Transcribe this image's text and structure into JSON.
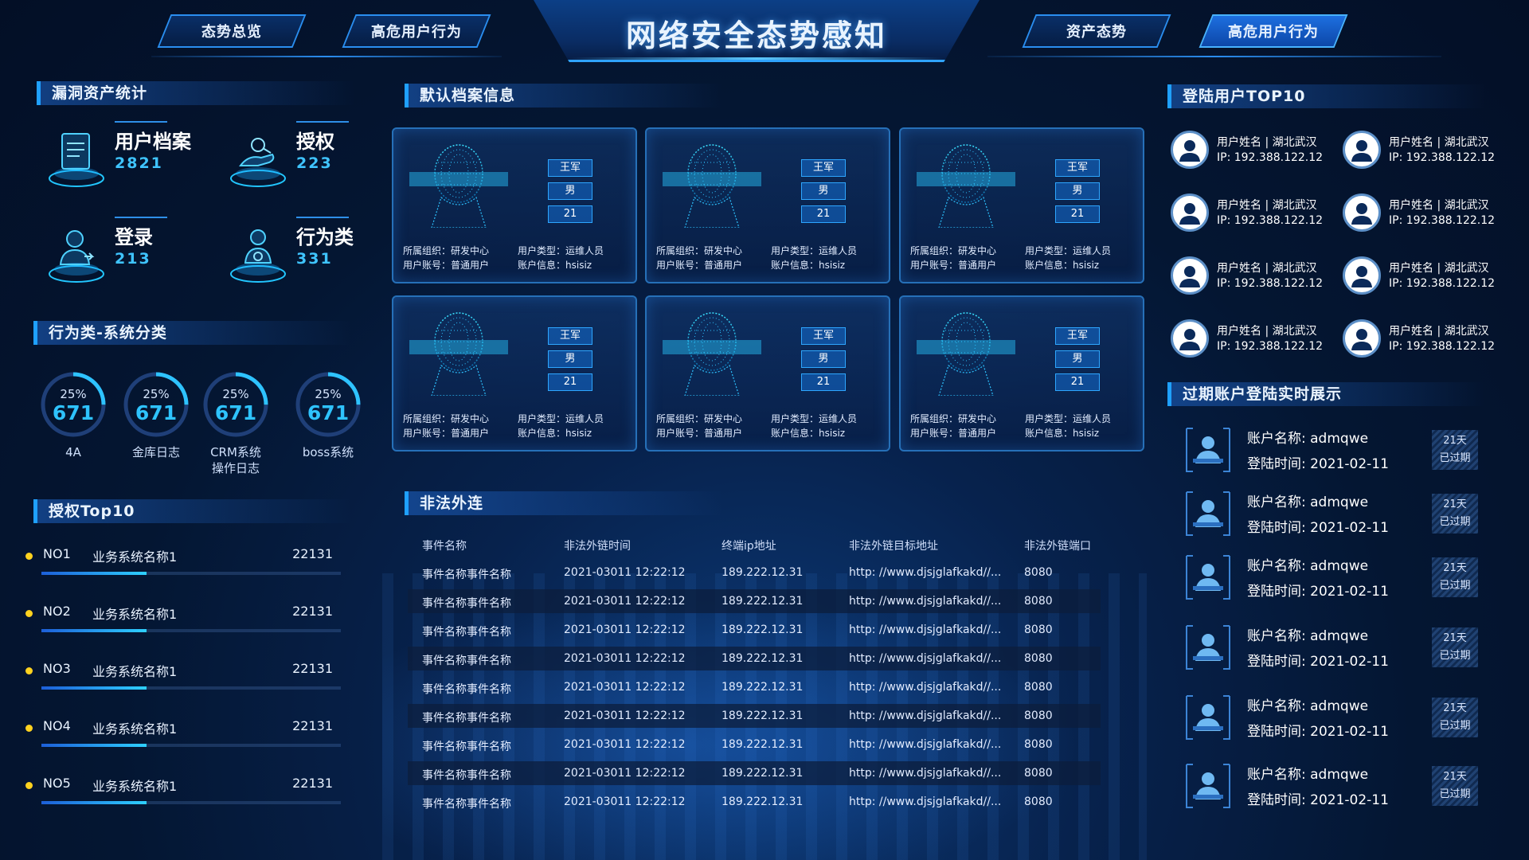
{
  "header": {
    "title": "网络安全态势感知",
    "tabs": [
      {
        "label": "态势总览",
        "active": false
      },
      {
        "label": "高危用户行为",
        "active": false
      },
      {
        "label": "资产态势",
        "active": false
      },
      {
        "label": "高危用户行为",
        "active": true
      }
    ]
  },
  "sections": {
    "assets": "漏洞资产统计",
    "behavior": "行为类-系统分类",
    "auth_top": "授权Top10",
    "profiles": "默认档案信息",
    "illegal": "非法外连",
    "login_top": "登陆用户TOP10",
    "expired": "过期账户登陆实时展示"
  },
  "assets": [
    {
      "label": "用户档案",
      "value": "2821",
      "icon": "folder-icon"
    },
    {
      "label": "授权",
      "value": "223",
      "icon": "hand-key-icon"
    },
    {
      "label": "登录",
      "value": "213",
      "icon": "user-login-icon"
    },
    {
      "label": "行为类",
      "value": "331",
      "icon": "user-behavior-icon"
    }
  ],
  "gauges": [
    {
      "pct": "25%",
      "value": "671",
      "name": "4A",
      "percent": 25
    },
    {
      "pct": "25%",
      "value": "671",
      "name": "金库日志",
      "percent": 25
    },
    {
      "pct": "25%",
      "value": "671",
      "name": "CRM系统\n操作日志",
      "percent": 25
    },
    {
      "pct": "25%",
      "value": "671",
      "name": "boss系统",
      "percent": 25
    }
  ],
  "auth_top": [
    {
      "no": "NO1",
      "name": "业务系统名称1",
      "value": "22131",
      "fill": 0.35
    },
    {
      "no": "NO2",
      "name": "业务系统名称1",
      "value": "22131",
      "fill": 0.35
    },
    {
      "no": "NO3",
      "name": "业务系统名称1",
      "value": "22131",
      "fill": 0.35
    },
    {
      "no": "NO4",
      "name": "业务系统名称1",
      "value": "22131",
      "fill": 0.35
    },
    {
      "no": "NO5",
      "name": "业务系统名称1",
      "value": "22131",
      "fill": 0.35
    }
  ],
  "profiles": [
    {
      "name": "王军",
      "gender": "男",
      "age": "21",
      "org": "所属组织：研发中心",
      "type": "用户类型：运维人员",
      "account": "用户账号：普通用户",
      "info": "账户信息：hsisiz"
    },
    {
      "name": "王军",
      "gender": "男",
      "age": "21",
      "org": "所属组织：研发中心",
      "type": "用户类型：运维人员",
      "account": "用户账号：普通用户",
      "info": "账户信息：hsisiz"
    },
    {
      "name": "王军",
      "gender": "男",
      "age": "21",
      "org": "所属组织：研发中心",
      "type": "用户类型：运维人员",
      "account": "用户账号：普通用户",
      "info": "账户信息：hsisiz"
    },
    {
      "name": "王军",
      "gender": "男",
      "age": "21",
      "org": "所属组织：研发中心",
      "type": "用户类型：运维人员",
      "account": "用户账号：普通用户",
      "info": "账户信息：hsisiz"
    },
    {
      "name": "王军",
      "gender": "男",
      "age": "21",
      "org": "所属组织：研发中心",
      "type": "用户类型：运维人员",
      "account": "用户账号：普通用户",
      "info": "账户信息：hsisiz"
    },
    {
      "name": "王军",
      "gender": "男",
      "age": "21",
      "org": "所属组织：研发中心",
      "type": "用户类型：运维人员",
      "account": "用户账号：普通用户",
      "info": "账户信息：hsisiz"
    }
  ],
  "illegal": {
    "columns": [
      "事件名称",
      "非法外链时间",
      "终端ip地址",
      "非法外链目标地址",
      "非法外链端口"
    ],
    "rows": [
      [
        "事件名称事件名称",
        "2021-03011  12:22:12",
        "189.222.12.31",
        "http: //www.djsjglafkakd//...",
        "8080"
      ],
      [
        "事件名称事件名称",
        "2021-03011  12:22:12",
        "189.222.12.31",
        "http: //www.djsjglafkakd//...",
        "8080"
      ],
      [
        "事件名称事件名称",
        "2021-03011  12:22:12",
        "189.222.12.31",
        "http: //www.djsjglafkakd//...",
        "8080"
      ],
      [
        "事件名称事件名称",
        "2021-03011  12:22:12",
        "189.222.12.31",
        "http: //www.djsjglafkakd//...",
        "8080"
      ],
      [
        "事件名称事件名称",
        "2021-03011  12:22:12",
        "189.222.12.31",
        "http: //www.djsjglafkakd//...",
        "8080"
      ],
      [
        "事件名称事件名称",
        "2021-03011  12:22:12",
        "189.222.12.31",
        "http: //www.djsjglafkakd//...",
        "8080"
      ],
      [
        "事件名称事件名称",
        "2021-03011  12:22:12",
        "189.222.12.31",
        "http: //www.djsjglafkakd//...",
        "8080"
      ],
      [
        "事件名称事件名称",
        "2021-03011  12:22:12",
        "189.222.12.31",
        "http: //www.djsjglafkakd//...",
        "8080"
      ],
      [
        "事件名称事件名称",
        "2021-03011  12:22:12",
        "189.222.12.31",
        "http: //www.djsjglafkakd//...",
        "8080"
      ]
    ]
  },
  "login_top": [
    {
      "line1": "用户姓名 | 湖北武汉",
      "line2": "IP: 192.388.122.12"
    },
    {
      "line1": "用户姓名 | 湖北武汉",
      "line2": "IP: 192.388.122.12"
    },
    {
      "line1": "用户姓名 | 湖北武汉",
      "line2": "IP: 192.388.122.12"
    },
    {
      "line1": "用户姓名 | 湖北武汉",
      "line2": "IP: 192.388.122.12"
    },
    {
      "line1": "用户姓名 | 湖北武汉",
      "line2": "IP: 192.388.122.12"
    },
    {
      "line1": "用户姓名 | 湖北武汉",
      "line2": "IP: 192.388.122.12"
    },
    {
      "line1": "用户姓名 | 湖北武汉",
      "line2": "IP: 192.388.122.12"
    },
    {
      "line1": "用户姓名 | 湖北武汉",
      "line2": "IP: 192.388.122.12"
    }
  ],
  "expired": [
    {
      "name": "账户名称: admqwe",
      "time": "登陆时间: 2021-02-11",
      "days": "21天",
      "status": "已过期"
    },
    {
      "name": "账户名称: admqwe",
      "time": "登陆时间: 2021-02-11",
      "days": "21天",
      "status": "已过期"
    },
    {
      "name": "账户名称: admqwe",
      "time": "登陆时间: 2021-02-11",
      "days": "21天",
      "status": "已过期"
    },
    {
      "name": "账户名称: admqwe",
      "time": "登陆时间: 2021-02-11",
      "days": "21天",
      "status": "已过期"
    },
    {
      "name": "账户名称: admqwe",
      "time": "登陆时间: 2021-02-11",
      "days": "21天",
      "status": "已过期"
    },
    {
      "name": "账户名称: admqwe",
      "time": "登陆时间: 2021-02-11",
      "days": "21天",
      "status": "已过期"
    }
  ],
  "colors": {
    "accent": "#2ec3ff",
    "rank_dot": "#ffd21f",
    "panel_border": "#2670b8"
  }
}
